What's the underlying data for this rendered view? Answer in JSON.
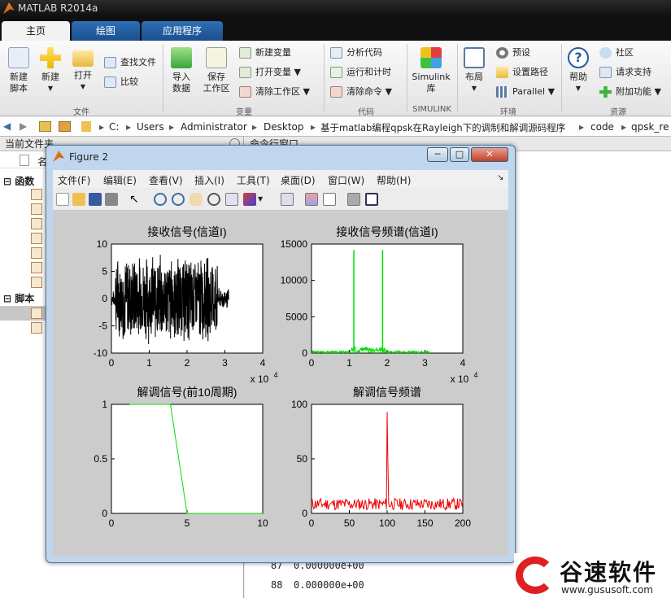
{
  "app": {
    "title": "MATLAB R2014a"
  },
  "tabs": [
    {
      "label": "主页"
    },
    {
      "label": "绘图"
    },
    {
      "label": "应用程序"
    }
  ],
  "ribbon": {
    "new_script": "新建\n脚本",
    "new": "新建",
    "open": "打开",
    "find_files": "查找文件",
    "compare": "比较",
    "import_data": "导入\n数据",
    "save_workspace": "保存\n工作区",
    "new_variable": "新建变量",
    "open_variable": "打开变量",
    "clear_workspace": "清除工作区",
    "analyze_code": "分析代码",
    "run_and_time": "运行和计时",
    "clear_commands": "清除命令",
    "simulink": "Simulink\n库",
    "layout": "布局",
    "preferences": "预设",
    "set_path": "设置路径",
    "parallel": "Parallel",
    "help": "帮助",
    "community": "社区",
    "request_support": "请求支持",
    "addons": "附加功能",
    "groups": {
      "file": "文件",
      "variable": "变量",
      "code": "代码",
      "simulink": "SIMULINK",
      "environment": "环境",
      "resources": "资源"
    }
  },
  "address": {
    "parts": [
      "C:",
      "Users",
      "Administrator",
      "Desktop",
      "基于matlab编程qpsk在Rayleigh下的调制和解调源码程序",
      "code",
      "qpsk_re"
    ]
  },
  "left_pane": {
    "title": "当前文件夹",
    "column": "名",
    "section_functions": "函数",
    "section_scripts": "脚本"
  },
  "right_pane": {
    "title": "命令行窗口",
    "lines": [
      {
        "n": "87",
        "v": "0.000000e+00"
      },
      {
        "n": "88",
        "v": "0.000000e+00"
      }
    ]
  },
  "figure": {
    "title": "Figure 2",
    "menu": [
      "文件(F)",
      "编辑(E)",
      "查看(V)",
      "插入(I)",
      "工具(T)",
      "桌面(D)",
      "窗口(W)",
      "帮助(H)"
    ]
  },
  "chart_data": [
    {
      "type": "line",
      "title": "接收信号(信道I)",
      "xlim": [
        0,
        4
      ],
      "ylim": [
        -10,
        10
      ],
      "x_ticks": [
        "0",
        "1",
        "2",
        "3",
        "4"
      ],
      "y_ticks": [
        "10",
        "5",
        "0",
        "-5",
        "-10"
      ],
      "x_exponent": "x 10",
      "x_exponent_power": "4",
      "color": "#000000",
      "envelope": {
        "x_start": 0,
        "x_end": 3.1,
        "amplitude_main": 8.5,
        "main_end": 2.8,
        "amplitude_tail": 2
      }
    },
    {
      "type": "line",
      "title": "接收信号频谱(信道I)",
      "xlim": [
        0,
        4
      ],
      "ylim": [
        0,
        15000
      ],
      "x_ticks": [
        "0",
        "1",
        "2",
        "3",
        "4"
      ],
      "y_ticks": [
        "15000",
        "10000",
        "5000",
        "0"
      ],
      "x_exponent": "x 10",
      "x_exponent_power": "4",
      "color": "#00dd00",
      "peaks": [
        {
          "x": 1.12,
          "y": 14200
        },
        {
          "x": 1.88,
          "y": 14200
        }
      ],
      "x_end": 3.12
    },
    {
      "type": "line",
      "title": "解调信号(前10周期)",
      "xlim": [
        0,
        10
      ],
      "ylim": [
        0,
        1
      ],
      "x_ticks": [
        "0",
        "5",
        "10"
      ],
      "y_ticks": [
        "1",
        "0.5",
        "0"
      ],
      "color": "#00dd00",
      "points": [
        [
          1.2,
          1
        ],
        [
          3.9,
          1
        ],
        [
          5.0,
          0
        ],
        [
          10,
          0
        ]
      ]
    },
    {
      "type": "line",
      "title": "解调信号频谱",
      "xlim": [
        0,
        200
      ],
      "ylim": [
        0,
        100
      ],
      "x_ticks": [
        "0",
        "50",
        "100",
        "150",
        "200"
      ],
      "y_ticks": [
        "100",
        "50",
        "0"
      ],
      "color": "#ee0000",
      "peak": {
        "x": 100,
        "y": 93
      },
      "noise_level": [
        3,
        14
      ]
    }
  ],
  "watermark": {
    "text": "谷速软件",
    "url": "www.gususoft.com"
  }
}
